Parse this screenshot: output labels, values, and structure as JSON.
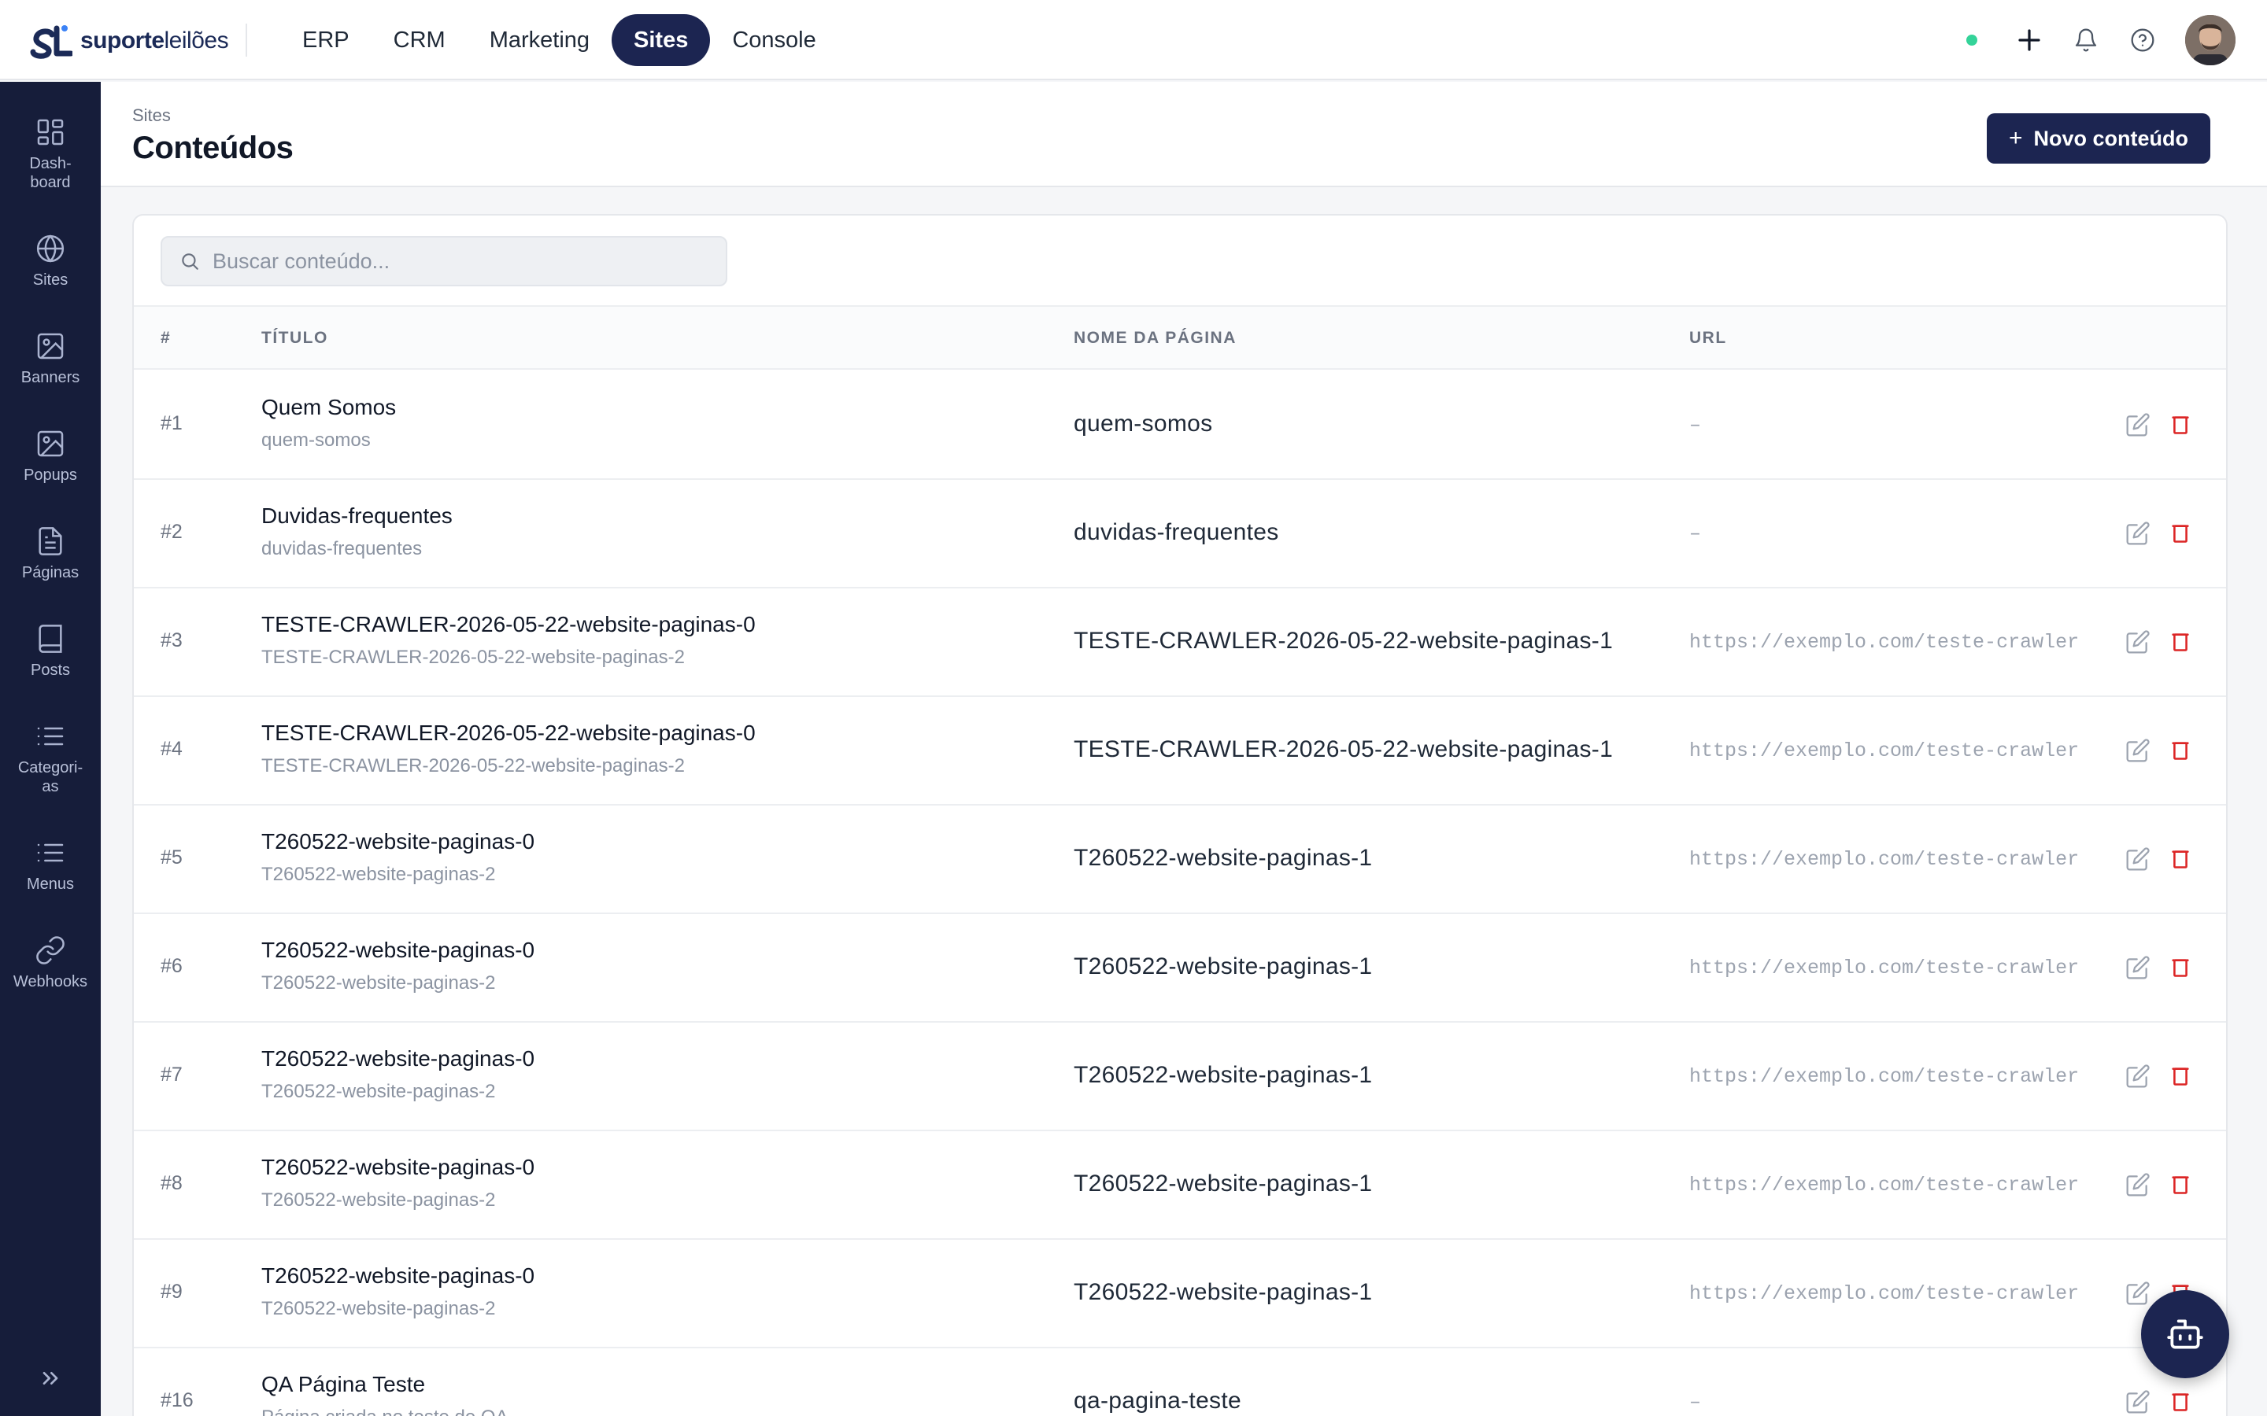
{
  "brand": {
    "name_bold": "suporte",
    "name_light": "leilões",
    "mark": "SL"
  },
  "topnav": {
    "items": [
      {
        "label": "ERP"
      },
      {
        "label": "CRM"
      },
      {
        "label": "Marketing"
      },
      {
        "label": "Sites",
        "active": true
      },
      {
        "label": "Console"
      }
    ]
  },
  "sidebar": {
    "items": [
      {
        "label": "Dash-\nboard",
        "icon": "dashboard-icon"
      },
      {
        "label": "Sites",
        "icon": "globe-icon"
      },
      {
        "label": "Banners",
        "icon": "image-icon"
      },
      {
        "label": "Popups",
        "icon": "image-icon"
      },
      {
        "label": "Páginas",
        "icon": "file-icon"
      },
      {
        "label": "Posts",
        "icon": "book-icon"
      },
      {
        "label": "Categori-\nas",
        "icon": "list-icon"
      },
      {
        "label": "Menus",
        "icon": "list-icon"
      },
      {
        "label": "Webhooks",
        "icon": "link-icon"
      }
    ]
  },
  "header": {
    "breadcrumb": "Sites",
    "title": "Conteúdos",
    "new_button_label": "Novo conteúdo"
  },
  "search": {
    "placeholder": "Buscar conteúdo..."
  },
  "table": {
    "columns": {
      "id": "#",
      "title": "TÍTULO",
      "page_name": "NOME DA PÁGINA",
      "url": "URL"
    },
    "rows": [
      {
        "id": "#1",
        "title": "Quem Somos",
        "slug": "quem-somos",
        "page_name": "quem-somos",
        "url": "–"
      },
      {
        "id": "#2",
        "title": "Duvidas-frequentes",
        "slug": "duvidas-frequentes",
        "page_name": "duvidas-frequentes",
        "url": "–"
      },
      {
        "id": "#3",
        "title": "TESTE-CRAWLER-2026-05-22-website-paginas-0",
        "slug": "TESTE-CRAWLER-2026-05-22-website-paginas-2",
        "page_name": "TESTE-CRAWLER-2026-05-22-website-paginas-1",
        "url": "https://exemplo.com/teste-crawler"
      },
      {
        "id": "#4",
        "title": "TESTE-CRAWLER-2026-05-22-website-paginas-0",
        "slug": "TESTE-CRAWLER-2026-05-22-website-paginas-2",
        "page_name": "TESTE-CRAWLER-2026-05-22-website-paginas-1",
        "url": "https://exemplo.com/teste-crawler"
      },
      {
        "id": "#5",
        "title": "T260522-website-paginas-0",
        "slug": "T260522-website-paginas-2",
        "page_name": "T260522-website-paginas-1",
        "url": "https://exemplo.com/teste-crawler"
      },
      {
        "id": "#6",
        "title": "T260522-website-paginas-0",
        "slug": "T260522-website-paginas-2",
        "page_name": "T260522-website-paginas-1",
        "url": "https://exemplo.com/teste-crawler"
      },
      {
        "id": "#7",
        "title": "T260522-website-paginas-0",
        "slug": "T260522-website-paginas-2",
        "page_name": "T260522-website-paginas-1",
        "url": "https://exemplo.com/teste-crawler"
      },
      {
        "id": "#8",
        "title": "T260522-website-paginas-0",
        "slug": "T260522-website-paginas-2",
        "page_name": "T260522-website-paginas-1",
        "url": "https://exemplo.com/teste-crawler"
      },
      {
        "id": "#9",
        "title": "T260522-website-paginas-0",
        "slug": "T260522-website-paginas-2",
        "page_name": "T260522-website-paginas-1",
        "url": "https://exemplo.com/teste-crawler"
      },
      {
        "id": "#16",
        "title": "QA Página Teste",
        "slug": "Página criada no teste de QA",
        "page_name": "qa-pagina-teste",
        "url": "–"
      }
    ]
  },
  "colors": {
    "navy": "#1c2551",
    "sidebar": "#161d3a",
    "status_online": "#34d399",
    "danger": "#dc2626"
  }
}
